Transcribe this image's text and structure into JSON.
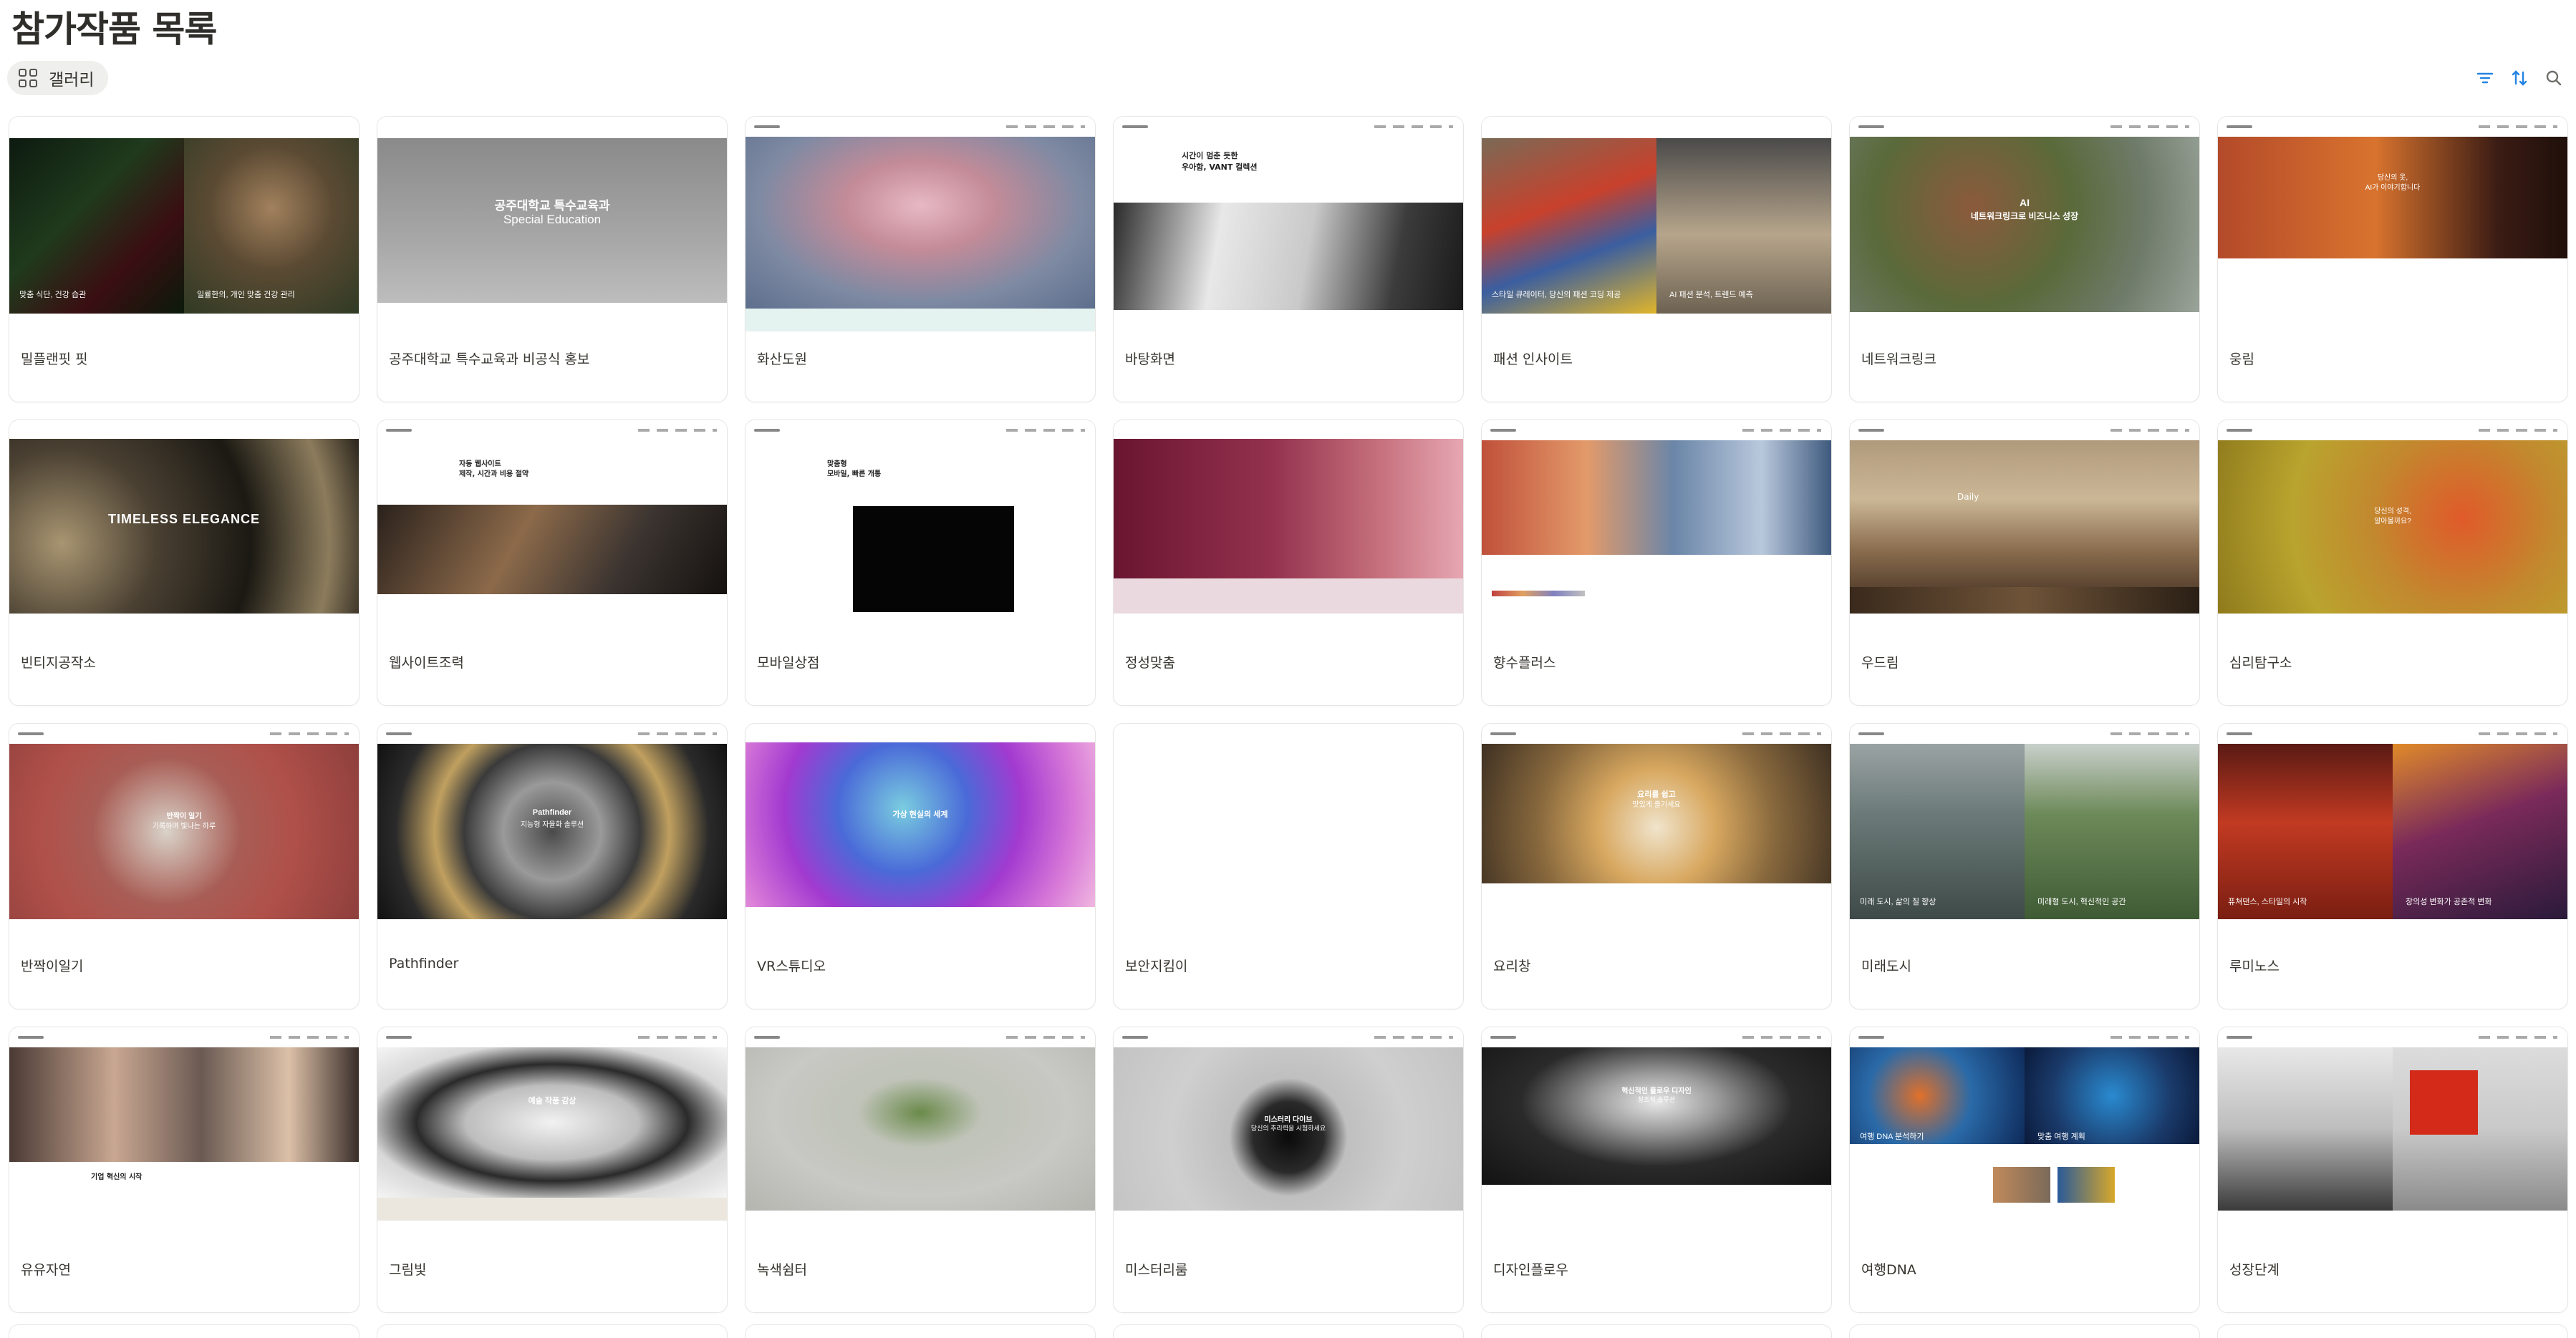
{
  "page": {
    "title": "참가작품 목록",
    "view_tab": {
      "label": "갤러리",
      "icon": "gallery-grid-icon"
    },
    "toolbar": [
      {
        "name": "filter-icon"
      },
      {
        "name": "sort-icon"
      },
      {
        "name": "search-icon"
      }
    ]
  },
  "cards": [
    {
      "name": "밀플랜핏 핏",
      "caption_l": "맞춤 식단, 건강 습관",
      "caption_r": "일률한의, 개인 맞춤 건강 관리"
    },
    {
      "name": "공주대학교 특수교육과 비공식 홍보",
      "headline": "공주대학교 특수교육과",
      "subline": "Special Education"
    },
    {
      "name": "화산도원"
    },
    {
      "name": "바탕화면",
      "headline": "시간이 멈춘 듯한",
      "subline": "우아함, VANT 컬렉션"
    },
    {
      "name": "패션 인사이트",
      "caption_l": "스타일 큐레이터, 당신의 패션 코딩 제공",
      "caption_r": "AI 패션 분석, 트렌드 예측"
    },
    {
      "name": "네트워크링크",
      "headline": "AI",
      "subline": "네트워크링크로 비즈니스 성장"
    },
    {
      "name": "웅림",
      "headline": "당신의 옷,",
      "subline": "AI가 이야기합니다"
    },
    {
      "name": "빈티지공작소",
      "headline": "TIMELESS ELEGANCE"
    },
    {
      "name": "웹사이트조력",
      "headline": "자동 웹사이트",
      "subline": "제작, 시간과 비용 절약"
    },
    {
      "name": "모바일상점",
      "headline": "맞춤형",
      "subline": "모바일, 빠른 개통"
    },
    {
      "name": "정성맞춤"
    },
    {
      "name": "향수플러스"
    },
    {
      "name": "우드림",
      "headline": "Daily"
    },
    {
      "name": "심리탐구소",
      "headline": "당신의 성격,",
      "subline": "알아볼까요?"
    },
    {
      "name": "반짝이일기",
      "headline": "반짝이 일기",
      "subline": "기록하며 빛나는 하루"
    },
    {
      "name": "Pathfinder",
      "headline": "Pathfinder",
      "subline": "지능형 자율화 솔루션"
    },
    {
      "name": "VR스튜디오",
      "headline": "가상 현실의 세계"
    },
    {
      "name": "보안지킴이"
    },
    {
      "name": "요리창",
      "headline": "요리를 쉽고",
      "subline": "맛있게 즐기세요"
    },
    {
      "name": "미래도시",
      "caption_l": "미래 도시, 삶의 질 향상",
      "caption_r": "미래형 도시, 혁신적인 공간"
    },
    {
      "name": "루미노스",
      "caption_l": "퓨쳐댄스, 스타일의 시작",
      "caption_r": "창의성 변화가 공존적 변화"
    },
    {
      "name": "유유자연",
      "headline": "기업 혁신의 시작"
    },
    {
      "name": "그림빛",
      "headline": "예술 작품 감상"
    },
    {
      "name": "녹색쉼터",
      "headline": ""
    },
    {
      "name": "미스터리룸",
      "headline": "미스터리 다이브",
      "subline": "당신의 추리력을 시험하세요"
    },
    {
      "name": "디자인플로우",
      "headline": "혁신적인 플로우 디자인",
      "subline": "창조적 솔루션"
    },
    {
      "name": "여행DNA",
      "caption_l": "여행 DNA 분석하기",
      "caption_r": "맞춤 여행 계획"
    },
    {
      "name": "성장단계"
    }
  ],
  "colors": {
    "card_border": "#e6e6e3",
    "title_text": "#2f2e2b",
    "toolbar_accent": "#2383e2"
  }
}
